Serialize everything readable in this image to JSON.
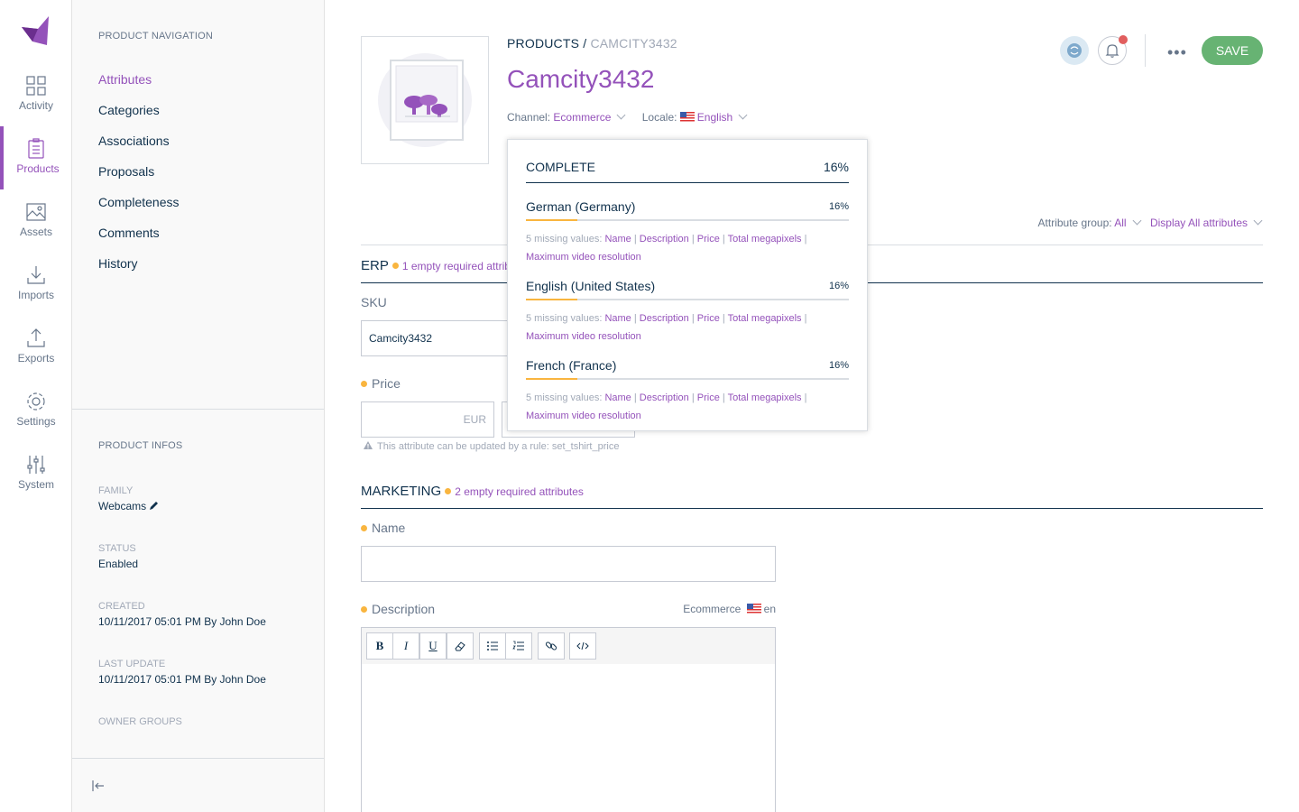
{
  "main_menu": {
    "items": [
      {
        "label": "Activity",
        "icon": "dashboard-icon"
      },
      {
        "label": "Products",
        "icon": "product-icon",
        "active": true
      },
      {
        "label": "Assets",
        "icon": "assets-icon"
      },
      {
        "label": "Imports",
        "icon": "import-icon"
      },
      {
        "label": "Exports",
        "icon": "export-icon"
      },
      {
        "label": "Settings",
        "icon": "gear-icon"
      },
      {
        "label": "System",
        "icon": "sliders-icon"
      }
    ]
  },
  "column": {
    "nav_title": "PRODUCT NAVIGATION",
    "nav_items": [
      "Attributes",
      "Categories",
      "Associations",
      "Proposals",
      "Completeness",
      "Comments",
      "History"
    ],
    "infos_title": "PRODUCT INFOS",
    "family_label": "FAMILY",
    "family_value": "Webcams",
    "status_label": "STATUS",
    "status_value": "Enabled",
    "created_label": "CREATED",
    "created_value": "10/11/2017 05:01 PM By John Doe",
    "last_update_label": "LAST UPDATE",
    "last_update_value": "10/11/2017 05:01 PM By John Doe",
    "owner_groups_label": "OWNER GROUPS"
  },
  "header": {
    "breadcrumb_root": "PRODUCTS",
    "breadcrumb_sep": " / ",
    "breadcrumb_current": "CAMCITY3432",
    "title": "Camcity3432",
    "channel_label": "Channel:",
    "channel_value": "Ecommerce",
    "locale_label": "Locale:",
    "locale_value": "English",
    "save_label": "SAVE",
    "more_label": "•••"
  },
  "filters": {
    "attribute_group_label": "Attribute group:",
    "attribute_group_value": "All",
    "display_label": "Display All attributes"
  },
  "groups": {
    "erp": {
      "title": "ERP",
      "required_text": "1 empty required attrib",
      "sku_label": "SKU",
      "sku_value": "Camcity3432",
      "price_label": "Price",
      "price_currency": "EUR",
      "price_helper": "This attribute can be updated by a rule: set_tshirt_price"
    },
    "marketing": {
      "title": "MARKETING",
      "required_text": "2 empty required attributes",
      "name_label": "Name",
      "description_label": "Description",
      "scope_channel": "Ecommerce",
      "scope_locale": "en"
    }
  },
  "rte_buttons": [
    "B",
    "I",
    "U",
    "eraser",
    "bullet-list",
    "numbered-list",
    "link",
    "code"
  ],
  "completeness": {
    "title": "COMPLETE",
    "ratio_label": "16%",
    "ratio": 0.16,
    "locales": [
      {
        "name": "German (Germany)",
        "ratio_label": "16%",
        "ratio": 0.16,
        "missing_label": "5 missing values:",
        "attributes": [
          "Name",
          "Description",
          "Price",
          "Total megapixels",
          "Maximum video resolution"
        ]
      },
      {
        "name": "English (United States)",
        "ratio_label": "16%",
        "ratio": 0.16,
        "missing_label": "5 missing values:",
        "attributes": [
          "Name",
          "Description",
          "Price",
          "Total megapixels",
          "Maximum video resolution"
        ]
      },
      {
        "name": "French (France)",
        "ratio_label": "16%",
        "ratio": 0.16,
        "missing_label": "5 missing values:",
        "attributes": [
          "Name",
          "Description",
          "Price",
          "Total megapixels",
          "Maximum video resolution"
        ]
      }
    ]
  },
  "colors": {
    "brand": "#9452ba",
    "save": "#67b373",
    "warning": "#f9b53f",
    "text": "#11324d",
    "muted": "#67768a"
  }
}
